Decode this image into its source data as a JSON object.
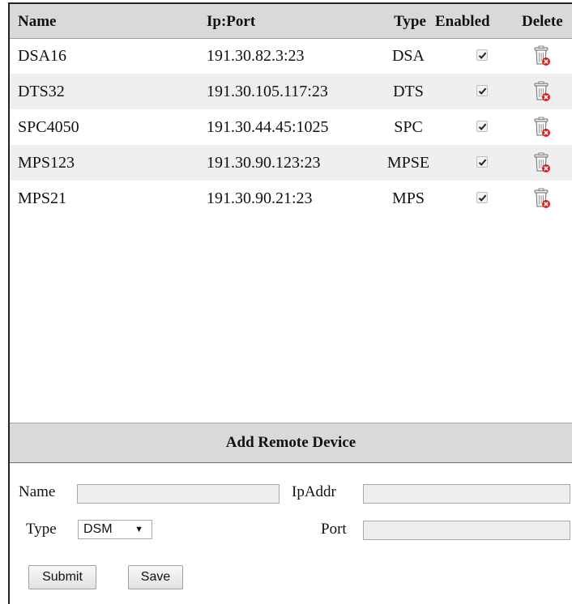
{
  "table": {
    "columns": {
      "name": "Name",
      "ip_port": "Ip:Port",
      "type": "Type",
      "enabled": "Enabled",
      "delete": "Delete"
    },
    "rows": [
      {
        "name": "DSA16",
        "ip_port": "191.30.82.3:23",
        "type": "DSA",
        "enabled": true
      },
      {
        "name": "DTS32",
        "ip_port": "191.30.105.117:23",
        "type": "DTS",
        "enabled": true
      },
      {
        "name": "SPC4050",
        "ip_port": "191.30.44.45:1025",
        "type": "SPC",
        "enabled": true
      },
      {
        "name": "MPS123",
        "ip_port": "191.30.90.123:23",
        "type": "MPSE",
        "enabled": true
      },
      {
        "name": "MPS21",
        "ip_port": "191.30.90.21:23",
        "type": "MPS",
        "enabled": true
      }
    ]
  },
  "add_device": {
    "title": "Add Remote Device",
    "name_label": "Name",
    "name_value": "",
    "ipaddr_label": "IpAddr",
    "ipaddr_value": "",
    "type_label": "Type",
    "type_selected": "DSM",
    "port_label": "Port",
    "port_value": "",
    "submit_label": "Submit",
    "save_label": "Save"
  },
  "icons": {
    "checkbox": "checkmark-icon",
    "delete": "trash-delete-icon"
  },
  "colors": {
    "header_bg": "#d9d9d9",
    "alt_row_bg": "#efefef",
    "input_bg": "#eeeeee",
    "delete_accent": "#d62020"
  }
}
